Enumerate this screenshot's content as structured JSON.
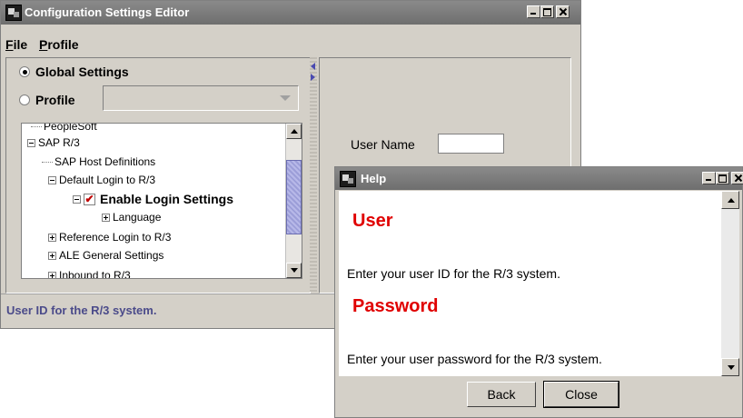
{
  "main_window": {
    "title": "Configuration Settings Editor",
    "menu": {
      "file": "File",
      "profile": "Profile"
    },
    "scope": {
      "global_label": "Global Settings",
      "global_checked": true,
      "profile_label": "Profile",
      "profile_checked": false,
      "profile_combo_value": ""
    },
    "tree": [
      {
        "label": "PeopleSoft",
        "type": "leaf"
      },
      {
        "label": "SAP R/3",
        "type": "expanded"
      },
      {
        "label": "SAP Host Definitions",
        "type": "leaf"
      },
      {
        "label": "Default Login to R/3",
        "type": "expanded"
      },
      {
        "label": "Enable Login Settings",
        "type": "checkbox",
        "checked": true,
        "selected": true
      },
      {
        "label": "Language",
        "type": "collapsed"
      },
      {
        "label": "Reference Login to R/3",
        "type": "collapsed"
      },
      {
        "label": "ALE General Settings",
        "type": "collapsed"
      },
      {
        "label": "Inbound to R/3",
        "type": "collapsed"
      }
    ],
    "detail": {
      "username_label": "User Name",
      "username_value": ""
    },
    "status_text": "User ID for the R/3 system."
  },
  "help_window": {
    "title": "Help",
    "heading_user": "User",
    "text_user": "Enter your user ID for the R/3 system.",
    "heading_password": "Password",
    "text_password": "Enter your user password for the R/3 system.",
    "back_label": "Back",
    "close_label": "Close"
  },
  "colors": {
    "titlebar": "#7a7a7a",
    "window_bg": "#d4d0c8",
    "help_heading": "#e00000",
    "status_text": "#4b4b8a",
    "checkbox_mark": "#c00000"
  },
  "icons": {
    "app": "java-app-icon",
    "minimize": "minimize-icon",
    "maximize": "maximize-icon",
    "close": "close-icon"
  }
}
